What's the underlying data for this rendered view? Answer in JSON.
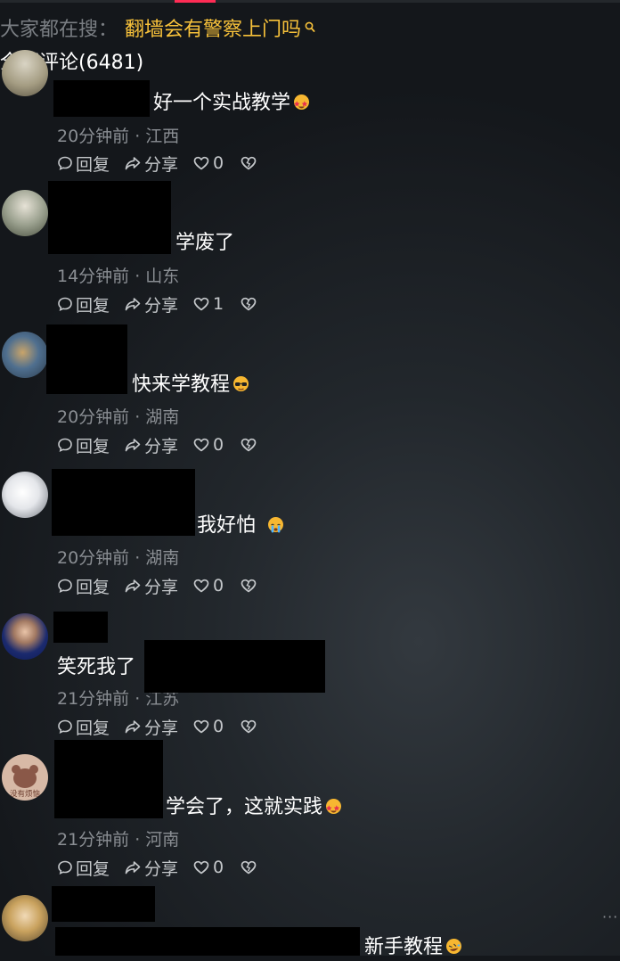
{
  "search": {
    "prefix": "大家都在搜：",
    "term": "翻墙会有警察上门吗",
    "icon": "search-icon"
  },
  "header": {
    "title": "全部评论(6481)"
  },
  "actions": {
    "reply": "回复",
    "share": "分享"
  },
  "colors": {
    "accent": "#ff2c55",
    "search_term": "#f7c13a",
    "meta": "#8a8e93",
    "background": "#1a1e22"
  },
  "comments": [
    {
      "text": "好一个实战教学",
      "emoji": "star-struck",
      "meta": "20分钟前 · 江西",
      "likes": "0"
    },
    {
      "text": "学废了",
      "emoji": "",
      "meta": "14分钟前 · 山东",
      "likes": "1"
    },
    {
      "text": "快来学教程",
      "emoji": "sunglasses",
      "meta": "20分钟前 · 湖南",
      "likes": "0"
    },
    {
      "text": "我好怕",
      "emoji": "crying",
      "meta": "20分钟前 · 湖南",
      "likes": "0"
    },
    {
      "text": "笑死我了",
      "emoji": "",
      "meta": "21分钟前 · 江苏",
      "likes": "0"
    },
    {
      "text": "学会了，这就实践",
      "emoji": "star-struck",
      "meta": "21分钟前 · 河南",
      "likes": "0"
    },
    {
      "text": "新手教程",
      "emoji": "rofl",
      "meta": "",
      "likes": ""
    }
  ],
  "avatar_text": "没有烦恼",
  "more": "···"
}
